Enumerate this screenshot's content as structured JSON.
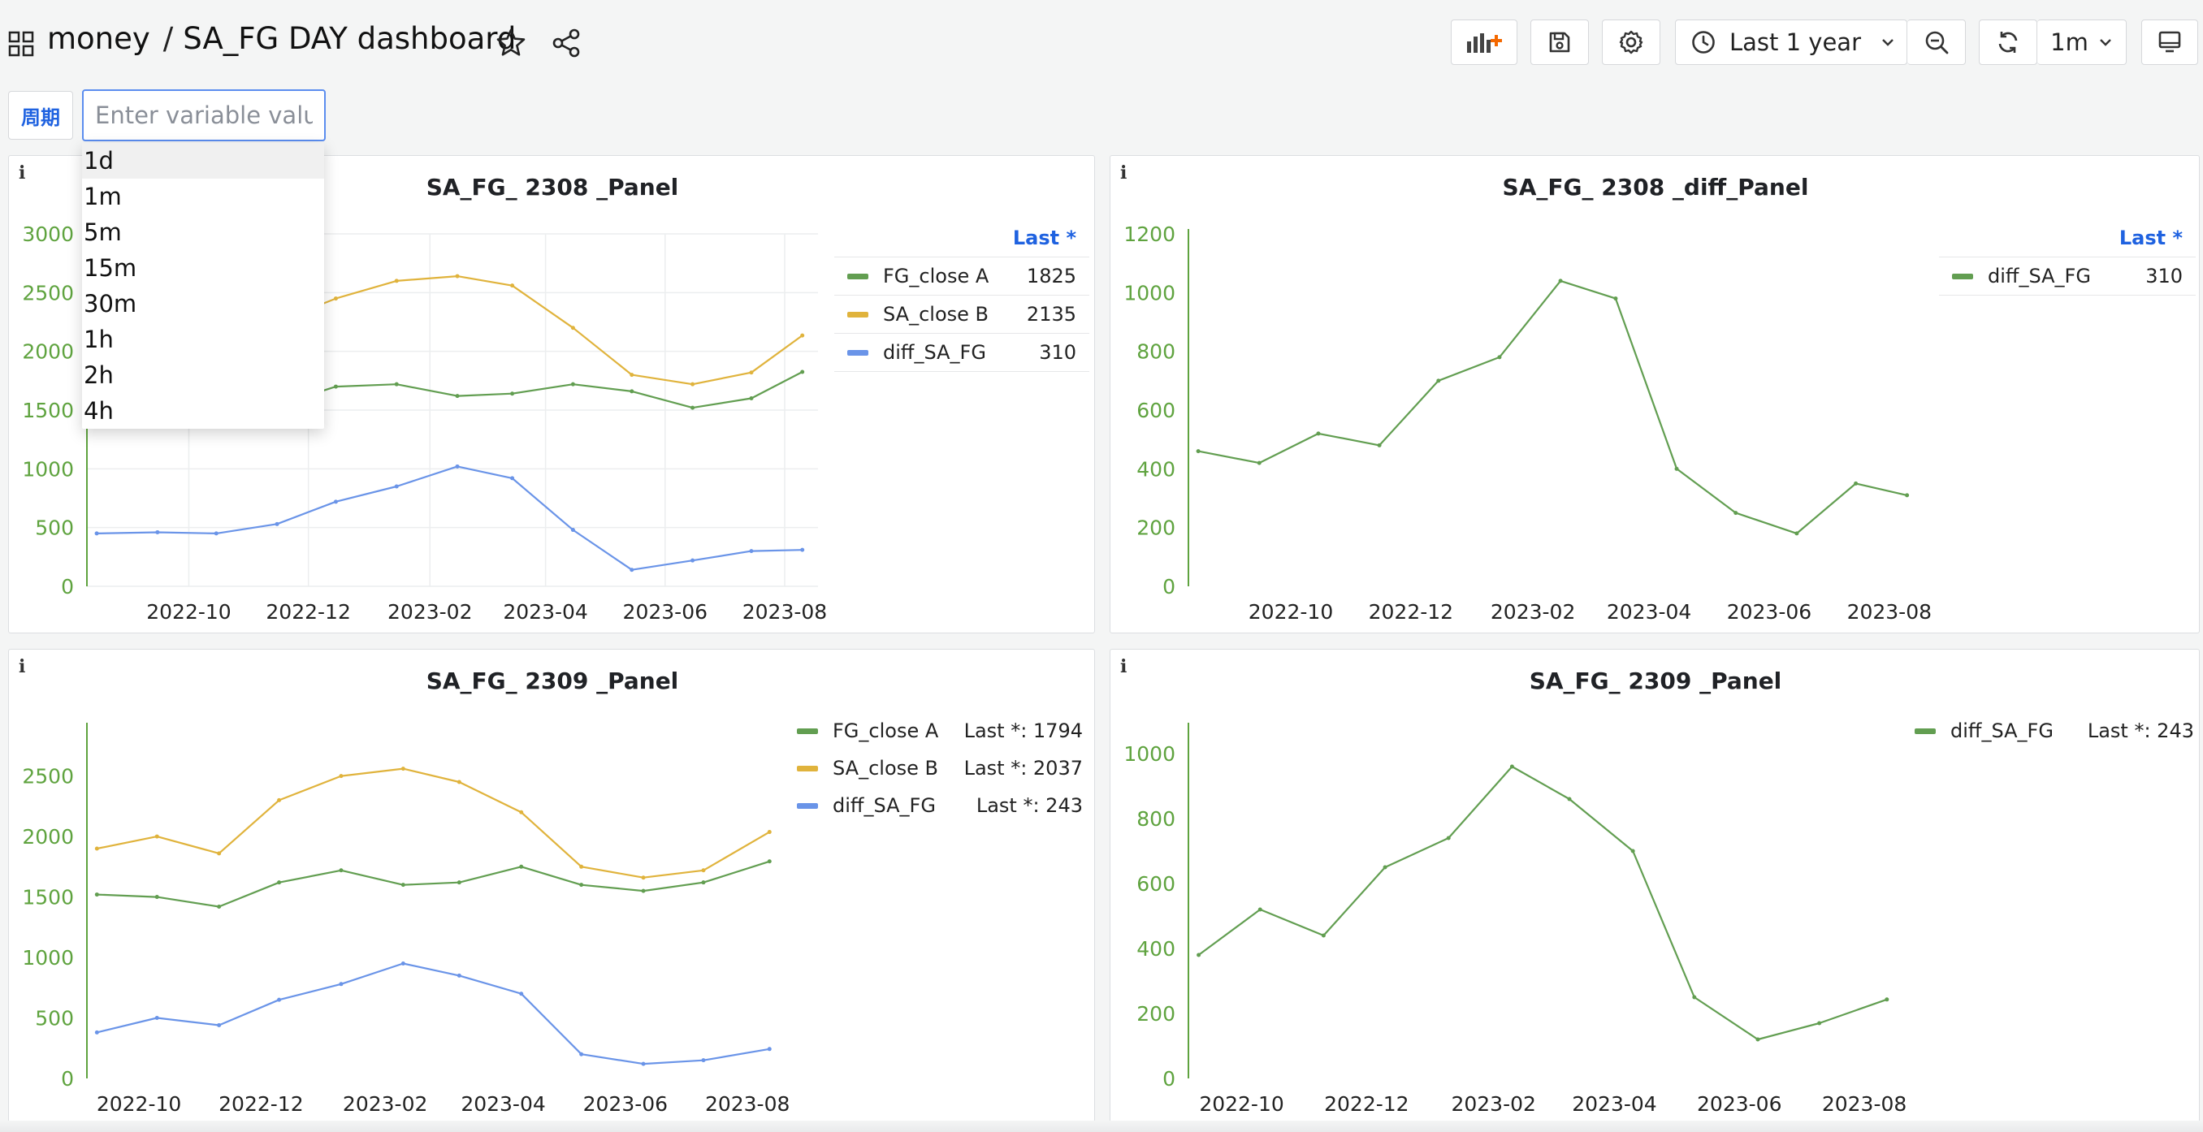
{
  "header": {
    "folder": "money",
    "separator": "/",
    "dashboard": "SA_FG DAY dashboard"
  },
  "toolbar": {
    "time_range": "Last 1 year",
    "refresh_interval": "1m"
  },
  "variable": {
    "label": "周期",
    "placeholder": "Enter variable value",
    "options": [
      "1d",
      "1m",
      "5m",
      "15m",
      "30m",
      "1h",
      "2h",
      "4h"
    ],
    "highlighted_index": 0
  },
  "colors": {
    "green": "#629e51",
    "yellow": "#e0b33c",
    "blue": "#6a94e8",
    "axis": "#5fa33f",
    "accent": "#1f62e0"
  },
  "panels": [
    {
      "info": "i",
      "title": "SA_FG_ 2308 _Panel",
      "legend_header": "Last *",
      "legend": [
        {
          "name": "FG_close A",
          "value": "1825"
        },
        {
          "name": "SA_close B",
          "value": "2135"
        },
        {
          "name": "diff_SA_FG",
          "value": "310"
        }
      ]
    },
    {
      "info": "i",
      "title": "SA_FG_ 2308 _diff_Panel",
      "legend_header": "Last *",
      "legend": [
        {
          "name": "diff_SA_FG",
          "value": "310"
        }
      ]
    },
    {
      "info": "i",
      "title": "SA_FG_ 2309 _Panel",
      "legend": [
        {
          "name": "FG_close A",
          "value": "Last *: 1794"
        },
        {
          "name": "SA_close B",
          "value": "Last *: 2037"
        },
        {
          "name": "diff_SA_FG",
          "value": "Last *: 243"
        }
      ]
    },
    {
      "info": "i",
      "title": "SA_FG_ 2309 _Panel",
      "legend": [
        {
          "name": "diff_SA_FG",
          "value": "Last *: 243"
        }
      ]
    }
  ],
  "chart_data": [
    {
      "type": "line",
      "title": "SA_FG_ 2308 _Panel",
      "x_ticks": [
        "2022-10",
        "2022-12",
        "2023-02",
        "2023-04",
        "2023-06",
        "2023-08"
      ],
      "y_ticks": [
        "0",
        "500",
        "1000",
        "1500",
        "2000",
        "2500",
        "3000"
      ],
      "ylim": [
        0,
        3000
      ],
      "x": [
        "2022-08-15",
        "2022-09-15",
        "2022-10-15",
        "2022-11-15",
        "2022-12-15",
        "2023-01-15",
        "2023-02-15",
        "2023-03-15",
        "2023-04-15",
        "2023-05-15",
        "2023-06-15",
        "2023-07-15",
        "2023-08-10"
      ],
      "series": [
        {
          "name": "FG_close A",
          "color": "#629e51",
          "values": [
            1550,
            1530,
            1500,
            1540,
            1700,
            1720,
            1620,
            1640,
            1720,
            1660,
            1520,
            1600,
            1825
          ]
        },
        {
          "name": "SA_close B",
          "color": "#e0b33c",
          "values": [
            2000,
            1990,
            1950,
            2250,
            2450,
            2600,
            2640,
            2560,
            2200,
            1800,
            1720,
            1820,
            2135
          ]
        },
        {
          "name": "diff_SA_FG",
          "color": "#6a94e8",
          "values": [
            450,
            460,
            450,
            530,
            720,
            850,
            1020,
            920,
            480,
            140,
            220,
            300,
            310
          ]
        }
      ]
    },
    {
      "type": "line",
      "title": "SA_FG_ 2308 _diff_Panel",
      "x_ticks": [
        "2022-10",
        "2022-12",
        "2023-02",
        "2023-04",
        "2023-06",
        "2023-08"
      ],
      "y_ticks": [
        "0",
        "200",
        "400",
        "600",
        "800",
        "1000",
        "1200"
      ],
      "ylim": [
        0,
        1200
      ],
      "x": [
        "2022-08-15",
        "2022-09-15",
        "2022-10-15",
        "2022-11-15",
        "2022-12-15",
        "2023-01-15",
        "2023-02-15",
        "2023-03-15",
        "2023-04-15",
        "2023-05-15",
        "2023-06-15",
        "2023-07-15",
        "2023-08-10"
      ],
      "series": [
        {
          "name": "diff_SA_FG",
          "color": "#629e51",
          "values": [
            460,
            420,
            520,
            480,
            700,
            780,
            1040,
            980,
            400,
            250,
            180,
            350,
            310
          ]
        }
      ]
    },
    {
      "type": "line",
      "title": "SA_FG_ 2309 _Panel",
      "x_ticks": [
        "2022-10",
        "2022-12",
        "2023-02",
        "2023-04",
        "2023-06",
        "2023-08"
      ],
      "y_ticks": [
        "0",
        "500",
        "1000",
        "1500",
        "2000",
        "2500"
      ],
      "ylim": [
        0,
        2900
      ],
      "x": [
        "2022-09-10",
        "2022-10-10",
        "2022-11-10",
        "2022-12-10",
        "2023-01-10",
        "2023-02-10",
        "2023-03-10",
        "2023-04-10",
        "2023-05-10",
        "2023-06-10",
        "2023-07-10",
        "2023-08-12"
      ],
      "series": [
        {
          "name": "FG_close A",
          "color": "#629e51",
          "values": [
            1520,
            1500,
            1420,
            1620,
            1720,
            1600,
            1620,
            1750,
            1600,
            1550,
            1620,
            1794
          ]
        },
        {
          "name": "SA_close B",
          "color": "#e0b33c",
          "values": [
            1900,
            2000,
            1860,
            2300,
            2500,
            2560,
            2450,
            2200,
            1750,
            1660,
            1720,
            2037
          ]
        },
        {
          "name": "diff_SA_FG",
          "color": "#6a94e8",
          "values": [
            380,
            500,
            440,
            650,
            780,
            950,
            850,
            700,
            200,
            120,
            150,
            243
          ]
        }
      ]
    },
    {
      "type": "line",
      "title": "SA_FG_ 2309 _Panel",
      "x_ticks": [
        "2022-10",
        "2022-12",
        "2023-02",
        "2023-04",
        "2023-06",
        "2023-08"
      ],
      "y_ticks": [
        "0",
        "200",
        "400",
        "600",
        "800",
        "1000"
      ],
      "ylim": [
        0,
        1080
      ],
      "x": [
        "2022-09-10",
        "2022-10-10",
        "2022-11-10",
        "2022-12-10",
        "2023-01-10",
        "2023-02-10",
        "2023-03-10",
        "2023-04-10",
        "2023-05-10",
        "2023-06-10",
        "2023-07-10",
        "2023-08-12"
      ],
      "series": [
        {
          "name": "diff_SA_FG",
          "color": "#629e51",
          "values": [
            380,
            520,
            440,
            650,
            740,
            960,
            860,
            700,
            250,
            120,
            170,
            243
          ]
        }
      ]
    }
  ]
}
